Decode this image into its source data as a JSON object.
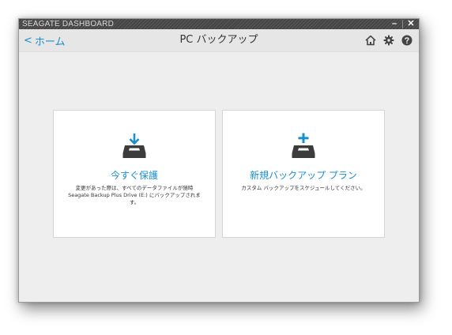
{
  "window": {
    "app_title": "SEAGATE DASHBOARD",
    "minimize_glyph": "–",
    "close_glyph": "✕"
  },
  "header": {
    "back_chevron": "<",
    "back_label": "ホーム",
    "page_title": "PC バックアップ",
    "icons": [
      "home-icon",
      "gear-icon",
      "help-icon"
    ]
  },
  "cards": [
    {
      "icon": "download-tray-icon",
      "title": "今すぐ保護",
      "description": "変更があった際は、すべてのデータファイルが随時 Seagate Backup Plus Drive (E:) にバックアップされます。"
    },
    {
      "icon": "add-tray-icon",
      "title": "新規バックアップ プラン",
      "description": "カスタム バックアップをスケジュールしてください。"
    }
  ],
  "colors": {
    "accent": "#1a8fd0",
    "titlebar": "#4a4a4a",
    "header_bg": "#e6e6e6",
    "body_bg": "#eeeeee",
    "icon_dark": "#3c3c3c"
  }
}
